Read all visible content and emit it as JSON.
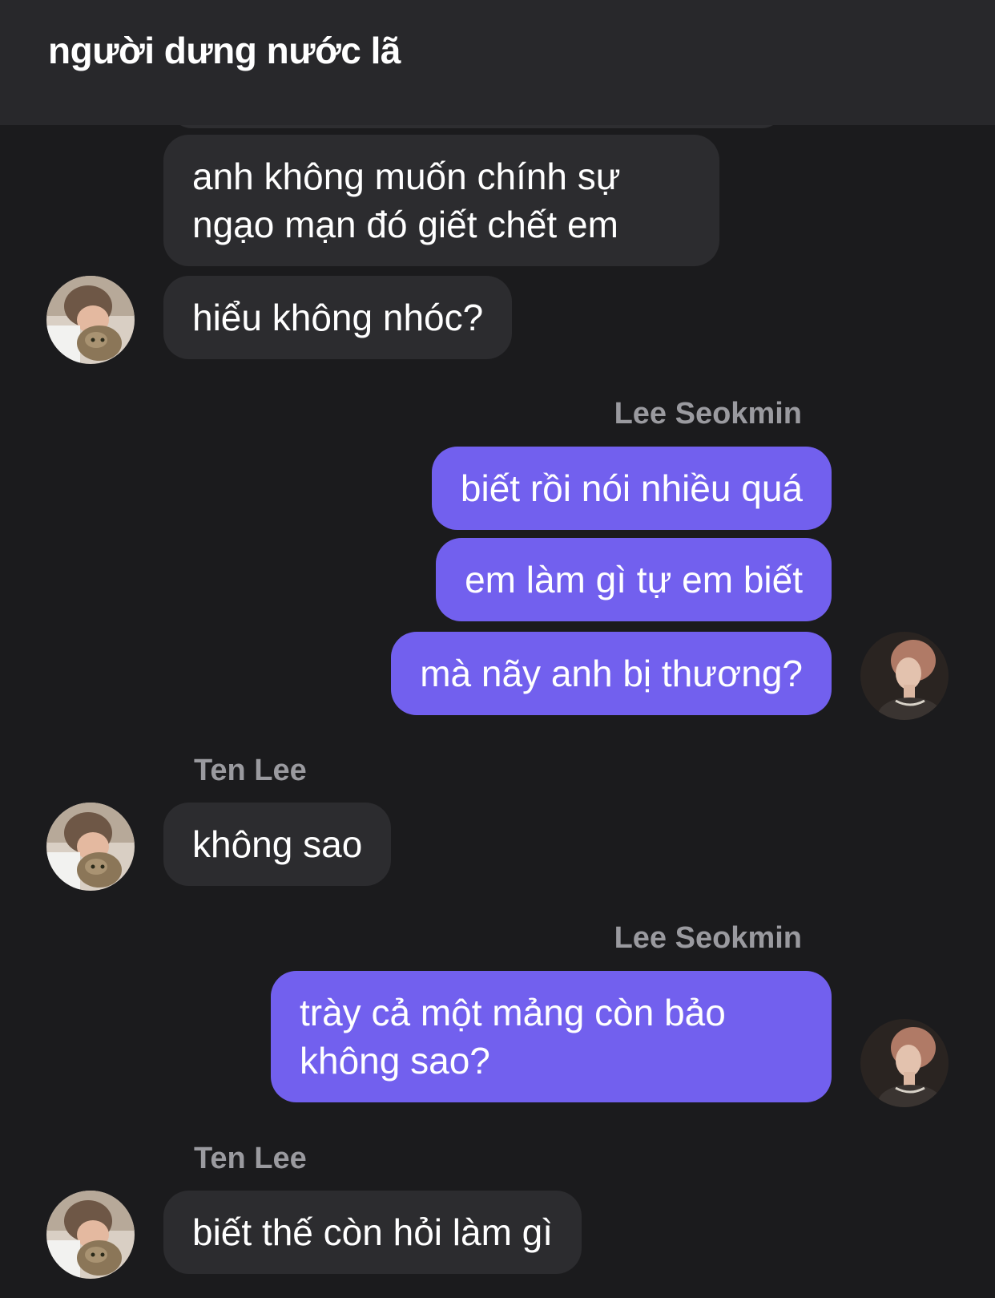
{
  "conversation": {
    "title": "người dưng nước lã"
  },
  "participants": {
    "other": "Ten Lee",
    "me": "Lee Seokmin"
  },
  "messages": [
    {
      "sender": "Ten Lee",
      "text": "anh không muốn chính sự ngạo mạn đó giết chết em"
    },
    {
      "sender": "Ten Lee",
      "text": "hiểu không nhóc?"
    },
    {
      "sender": "Lee Seokmin",
      "text": "biết rồi nói nhiều quá"
    },
    {
      "sender": "Lee Seokmin",
      "text": "em làm gì tự em biết"
    },
    {
      "sender": "Lee Seokmin",
      "text": "mà nãy anh bị thương?"
    },
    {
      "sender": "Ten Lee",
      "text": "không sao"
    },
    {
      "sender": "Lee Seokmin",
      "text": "trày cả một mảng còn bảo không sao?"
    },
    {
      "sender": "Ten Lee",
      "text": "biết thế còn hỏi làm gì"
    }
  ],
  "colors": {
    "background": "#1b1b1d",
    "header": "#28282b",
    "incoming_bubble": "#2c2c2f",
    "outgoing_bubble": "#7260ee",
    "sender_name": "#9a9a9f"
  },
  "avatars": {
    "other": "avatar-person-with-cat-photo",
    "me": "avatar-profile-photo"
  }
}
